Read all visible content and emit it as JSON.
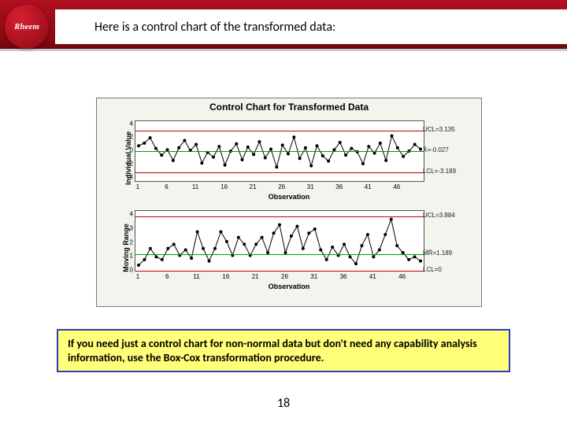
{
  "brand": "Rheem",
  "title": "Here is a control chart of the transformed data:",
  "note": "If you need just a control chart for non-normal data but don't need any capability analysis information, use the Box-Cox transformation procedure.",
  "page_number": "18",
  "chart_data": [
    {
      "type": "line",
      "title": "Control Chart for Transformed Data",
      "xlabel": "Observation",
      "ylabel": "Individual Value",
      "x_ticks": [
        1,
        6,
        11,
        16,
        21,
        26,
        31,
        36,
        41,
        46
      ],
      "y_ticks": [
        -4,
        -2,
        0,
        2,
        4
      ],
      "ylim": [
        -4.5,
        4.5
      ],
      "reference_lines": [
        {
          "label": "UCL=3.135",
          "value": 3.135,
          "color": "#c00000"
        },
        {
          "label": "X̄=-0.027",
          "value": -0.027,
          "color": "#00a000"
        },
        {
          "label": "LCL=-3.189",
          "value": -3.189,
          "color": "#c00000"
        }
      ],
      "series": [
        {
          "name": "Individual",
          "color": "#000",
          "values": [
            0.8,
            1.2,
            2.0,
            0.4,
            -0.6,
            0.2,
            -1.4,
            0.5,
            1.6,
            0.1,
            1.0,
            -1.8,
            -0.2,
            -0.9,
            0.7,
            -2.1,
            0.0,
            1.1,
            -1.3,
            0.6,
            -0.5,
            1.4,
            -1.0,
            0.3,
            -2.4,
            0.9,
            -0.4,
            2.1,
            -1.1,
            0.5,
            -2.2,
            0.8,
            -0.7,
            -1.5,
            0.2,
            1.3,
            -0.6,
            0.4,
            -0.1,
            -1.9,
            0.7,
            -0.3,
            1.2,
            -1.4,
            2.3,
            0.5,
            -0.8,
            0.0,
            1.0,
            0.3
          ]
        }
      ]
    },
    {
      "type": "line",
      "title": "",
      "xlabel": "Observation",
      "ylabel": "Moving Range",
      "x_ticks": [
        1,
        6,
        11,
        16,
        21,
        26,
        31,
        36,
        41,
        46
      ],
      "y_ticks": [
        0,
        1,
        2,
        3,
        4
      ],
      "ylim": [
        0,
        4.3
      ],
      "reference_lines": [
        {
          "label": "UCL=3.884",
          "value": 3.884,
          "color": "#c00000"
        },
        {
          "label": "M̄R̄=1.189",
          "value": 1.189,
          "color": "#00a000"
        },
        {
          "label": "LCL=0",
          "value": 0.0,
          "color": "#c00000"
        }
      ],
      "series": [
        {
          "name": "MR",
          "color": "#000",
          "values": [
            0.4,
            0.8,
            1.6,
            1.0,
            0.8,
            1.6,
            1.9,
            1.1,
            1.5,
            0.9,
            2.8,
            1.6,
            0.7,
            1.6,
            2.8,
            2.1,
            1.1,
            2.4,
            1.9,
            1.1,
            1.9,
            2.4,
            1.3,
            2.7,
            3.3,
            1.3,
            2.5,
            3.2,
            1.6,
            2.7,
            3.0,
            1.5,
            0.8,
            1.7,
            1.1,
            1.9,
            1.0,
            0.5,
            1.8,
            2.6,
            1.0,
            1.5,
            2.6,
            3.7,
            1.8,
            1.3,
            0.8,
            1.0,
            0.7
          ]
        }
      ]
    }
  ]
}
